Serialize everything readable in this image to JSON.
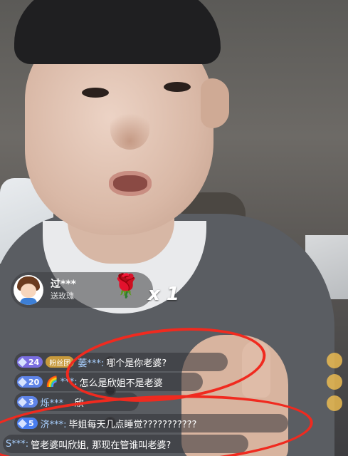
{
  "gift": {
    "user": "过***",
    "action": "送玫瑰",
    "gift_icon": "rose-icon",
    "count": "x 1"
  },
  "chat": {
    "messages": [
      {
        "level": "24",
        "badge": "粉丝团",
        "user": "萎***:",
        "text": "哪个是你老婆?"
      },
      {
        "level": "20",
        "badge": "",
        "user": "***:",
        "text": "怎么是欣姐不是老婆"
      },
      {
        "level": "3",
        "badge": "",
        "user": "烁***",
        "text": "...欣"
      },
      {
        "level": "5",
        "badge": "",
        "user": "济***:",
        "text": "毕姐每天几点睡觉???????????"
      },
      {
        "level": "",
        "badge": "",
        "user": "S***:",
        "text": "管老婆叫欣姐, 那现在管谁叫老婆?"
      }
    ]
  },
  "colors": {
    "annotation_red": "#f02a1f",
    "username_blue": "#a9d0ff"
  }
}
